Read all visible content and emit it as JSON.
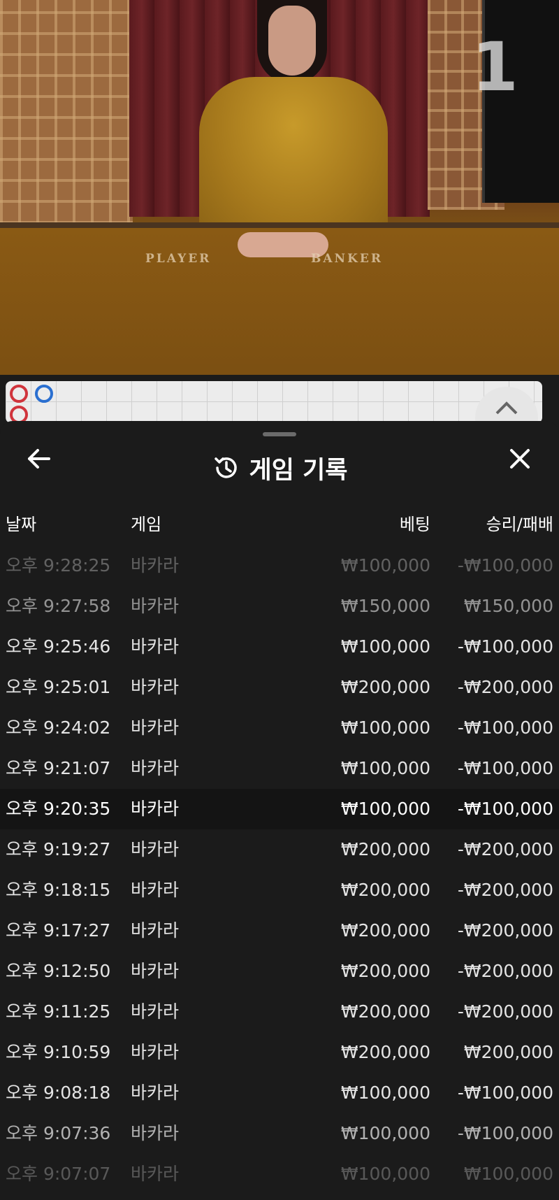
{
  "video": {
    "round_number": "1",
    "table_labels": {
      "player": "PLAYER",
      "banker": "BANKER"
    }
  },
  "sheet": {
    "title": "게임 기록",
    "icons": {
      "back": "arrow-left-icon",
      "history": "history-icon",
      "close": "close-icon"
    },
    "columns": {
      "date": "날짜",
      "game": "게임",
      "bet": "베팅",
      "result": "승리/패배"
    },
    "rows": [
      {
        "date": "오후 9:28:25",
        "game": "바카라",
        "bet": "₩100,000",
        "result": "-₩100,000"
      },
      {
        "date": "오후 9:27:58",
        "game": "바카라",
        "bet": "₩150,000",
        "result": "₩150,000"
      },
      {
        "date": "오후 9:25:46",
        "game": "바카라",
        "bet": "₩100,000",
        "result": "-₩100,000"
      },
      {
        "date": "오후 9:25:01",
        "game": "바카라",
        "bet": "₩200,000",
        "result": "-₩200,000"
      },
      {
        "date": "오후 9:24:02",
        "game": "바카라",
        "bet": "₩100,000",
        "result": "-₩100,000"
      },
      {
        "date": "오후 9:21:07",
        "game": "바카라",
        "bet": "₩100,000",
        "result": "-₩100,000"
      },
      {
        "date": "오후 9:20:35",
        "game": "바카라",
        "bet": "₩100,000",
        "result": "-₩100,000"
      },
      {
        "date": "오후 9:19:27",
        "game": "바카라",
        "bet": "₩200,000",
        "result": "-₩200,000"
      },
      {
        "date": "오후 9:18:15",
        "game": "바카라",
        "bet": "₩200,000",
        "result": "-₩200,000"
      },
      {
        "date": "오후 9:17:27",
        "game": "바카라",
        "bet": "₩200,000",
        "result": "-₩200,000"
      },
      {
        "date": "오후 9:12:50",
        "game": "바카라",
        "bet": "₩200,000",
        "result": "-₩200,000"
      },
      {
        "date": "오후 9:11:25",
        "game": "바카라",
        "bet": "₩200,000",
        "result": "-₩200,000"
      },
      {
        "date": "오후 9:10:59",
        "game": "바카라",
        "bet": "₩200,000",
        "result": "₩200,000"
      },
      {
        "date": "오후 9:08:18",
        "game": "바카라",
        "bet": "₩100,000",
        "result": "-₩100,000"
      },
      {
        "date": "오후 9:07:36",
        "game": "바카라",
        "bet": "₩100,000",
        "result": "-₩100,000"
      },
      {
        "date": "오후 9:07:07",
        "game": "바카라",
        "bet": "₩100,000",
        "result": "₩100,000"
      }
    ]
  }
}
